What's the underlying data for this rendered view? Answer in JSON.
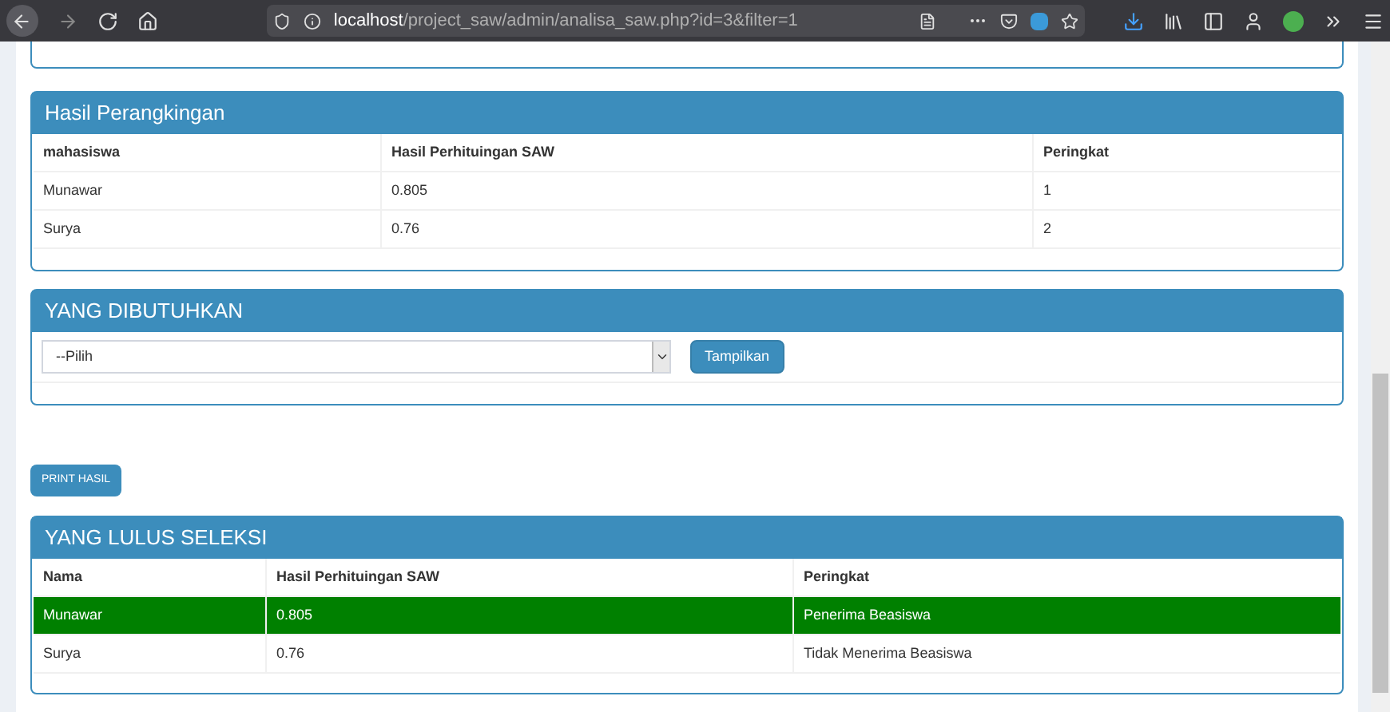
{
  "browser": {
    "url_host": "localhost",
    "url_path": "/project_saw/admin/analisa_saw.php?id=3&filter=1"
  },
  "ranking": {
    "title": "Hasil Perangkingan",
    "columns": [
      "mahasiswa",
      "Hasil Perhituingan SAW",
      "Peringkat"
    ],
    "rows": [
      [
        "Munawar",
        "0.805",
        "1"
      ],
      [
        "Surya",
        "0.76",
        "2"
      ]
    ]
  },
  "needed": {
    "title": "YANG DIBUTUHKAN",
    "select_value": "--Pilih",
    "button": "Tampilkan"
  },
  "print_button": "PRINT HASIL",
  "passed": {
    "title": "YANG LULUS SELEKSI",
    "columns": [
      "Nama",
      "Hasil Perhituingan SAW",
      "Peringkat"
    ],
    "rows": [
      {
        "cells": [
          "Munawar",
          "0.805",
          "Penerima Beasiswa"
        ],
        "highlighted": true
      },
      {
        "cells": [
          "Surya",
          "0.76",
          "Tidak Menerima Beasiswa"
        ],
        "highlighted": false
      }
    ]
  }
}
